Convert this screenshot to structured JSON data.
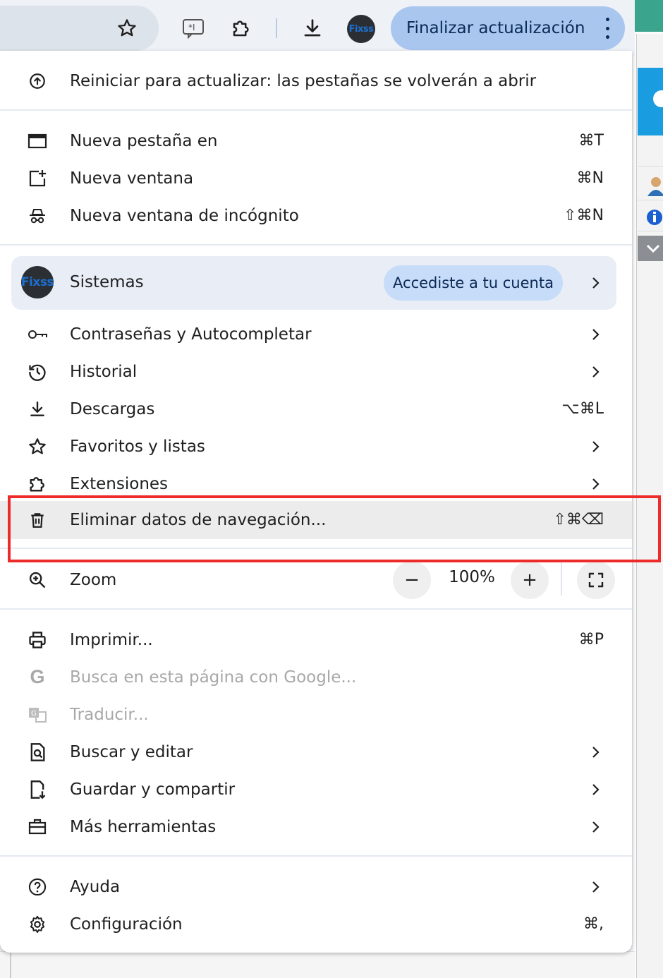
{
  "toolbar": {
    "update_button_label": "Finalizar actualización",
    "avatar_text": "Fixss"
  },
  "menu": {
    "restart": {
      "label": "Reiniciar para actualizar: las pestañas se volverán a abrir"
    },
    "new_tab": {
      "label": "Nueva pestaña en",
      "shortcut": "⌘T"
    },
    "new_window": {
      "label": "Nueva ventana",
      "shortcut": "⌘N"
    },
    "incognito": {
      "label": "Nueva ventana de incógnito",
      "shortcut": "⇧⌘N"
    },
    "profile": {
      "name": "Sistemas",
      "status": "AccedistE a tu cuenta",
      "avatar_text": "Fixss"
    },
    "passwords": {
      "label": "Contraseñas y Autocompletar"
    },
    "history": {
      "label": "Historial"
    },
    "downloads": {
      "label": "Descargas",
      "shortcut": "⌥⌘L"
    },
    "bookmarks": {
      "label": "Favoritos y listas"
    },
    "extensions": {
      "label": "Extensiones"
    },
    "clear_data": {
      "label": "Eliminar datos de navegación...",
      "shortcut": "⇧⌘⌫"
    },
    "zoom": {
      "label": "Zoom",
      "value": "100%",
      "minus": "−",
      "plus": "+"
    },
    "print": {
      "label": "Imprimir...",
      "shortcut": "⌘P"
    },
    "search_google": {
      "label": "Busca en esta página con Google..."
    },
    "translate": {
      "label": "Traducir..."
    },
    "find_edit": {
      "label": "Buscar y editar"
    },
    "save_share": {
      "label": "Guardar y compartir"
    },
    "more_tools": {
      "label": "Más herramientas"
    },
    "help": {
      "label": "Ayuda"
    },
    "settings": {
      "label": "Configuración",
      "shortcut": "⌘,"
    }
  },
  "colors": {
    "accent_pill": "#a9c6ef",
    "highlight_box": "#ee2b2b",
    "profile_bg": "#e9eef6"
  }
}
